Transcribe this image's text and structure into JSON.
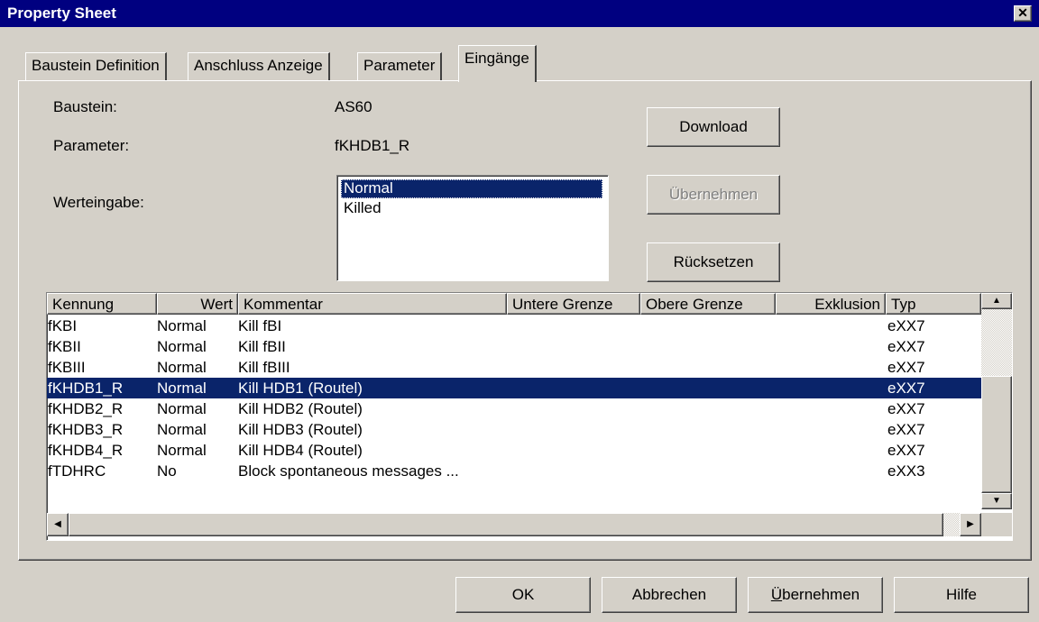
{
  "window": {
    "title": "Property Sheet",
    "close_glyph": "✕"
  },
  "tabs": [
    "Baustein Definition",
    "Anschluss Anzeige",
    "Parameter",
    "Eingänge"
  ],
  "active_tab": "Eingänge",
  "form": {
    "baustein_label": "Baustein:",
    "baustein_value": "AS60",
    "parameter_label": "Parameter:",
    "parameter_value": "fKHDB1_R",
    "werteingabe_label": "Werteingabe:",
    "options": [
      "Normal",
      "Killed"
    ],
    "selected_option": "Normal"
  },
  "buttons": {
    "download": "Download",
    "ubernehmen_disabled": "Übernehmen",
    "rucksetzen": "Rücksetzen"
  },
  "table": {
    "columns": [
      "Kennung",
      "Wert",
      "Kommentar",
      "Untere Grenze",
      "Obere Grenze",
      "Exklusion",
      "Typ"
    ],
    "rows": [
      [
        "fKBI",
        "Normal",
        "Kill fBI",
        "",
        "",
        "",
        "eXX7"
      ],
      [
        "fKBII",
        "Normal",
        "Kill fBII",
        "",
        "",
        "",
        "eXX7"
      ],
      [
        "fKBIII",
        "Normal",
        "Kill fBIII",
        "",
        "",
        "",
        "eXX7"
      ],
      [
        "fKHDB1_R",
        "Normal",
        "Kill HDB1 (Routel)",
        "",
        "",
        "",
        "eXX7"
      ],
      [
        "fKHDB2_R",
        "Normal",
        "Kill HDB2 (Routel)",
        "",
        "",
        "",
        "eXX7"
      ],
      [
        "fKHDB3_R",
        "Normal",
        "Kill HDB3 (Routel)",
        "",
        "",
        "",
        "eXX7"
      ],
      [
        "fKHDB4_R",
        "Normal",
        "Kill HDB4 (Routel)",
        "",
        "",
        "",
        "eXX7"
      ],
      [
        "fTDHRC",
        "No",
        "Block spontaneous messages ...",
        "",
        "",
        "",
        "eXX3"
      ]
    ],
    "selected_row": "fKHDB1_R"
  },
  "footer": {
    "ok": "OK",
    "cancel": "Abbrechen",
    "apply_prefix": "Ü",
    "apply_rest": "bernehmen",
    "help": "Hilfe"
  },
  "icons": {
    "scroll_up": "▲",
    "scroll_down": "▼",
    "scroll_left": "◀",
    "scroll_right": "▶"
  },
  "colors": {
    "title_bar": "#000080",
    "selection": "#0a246a",
    "face": "#d4d0c8"
  }
}
